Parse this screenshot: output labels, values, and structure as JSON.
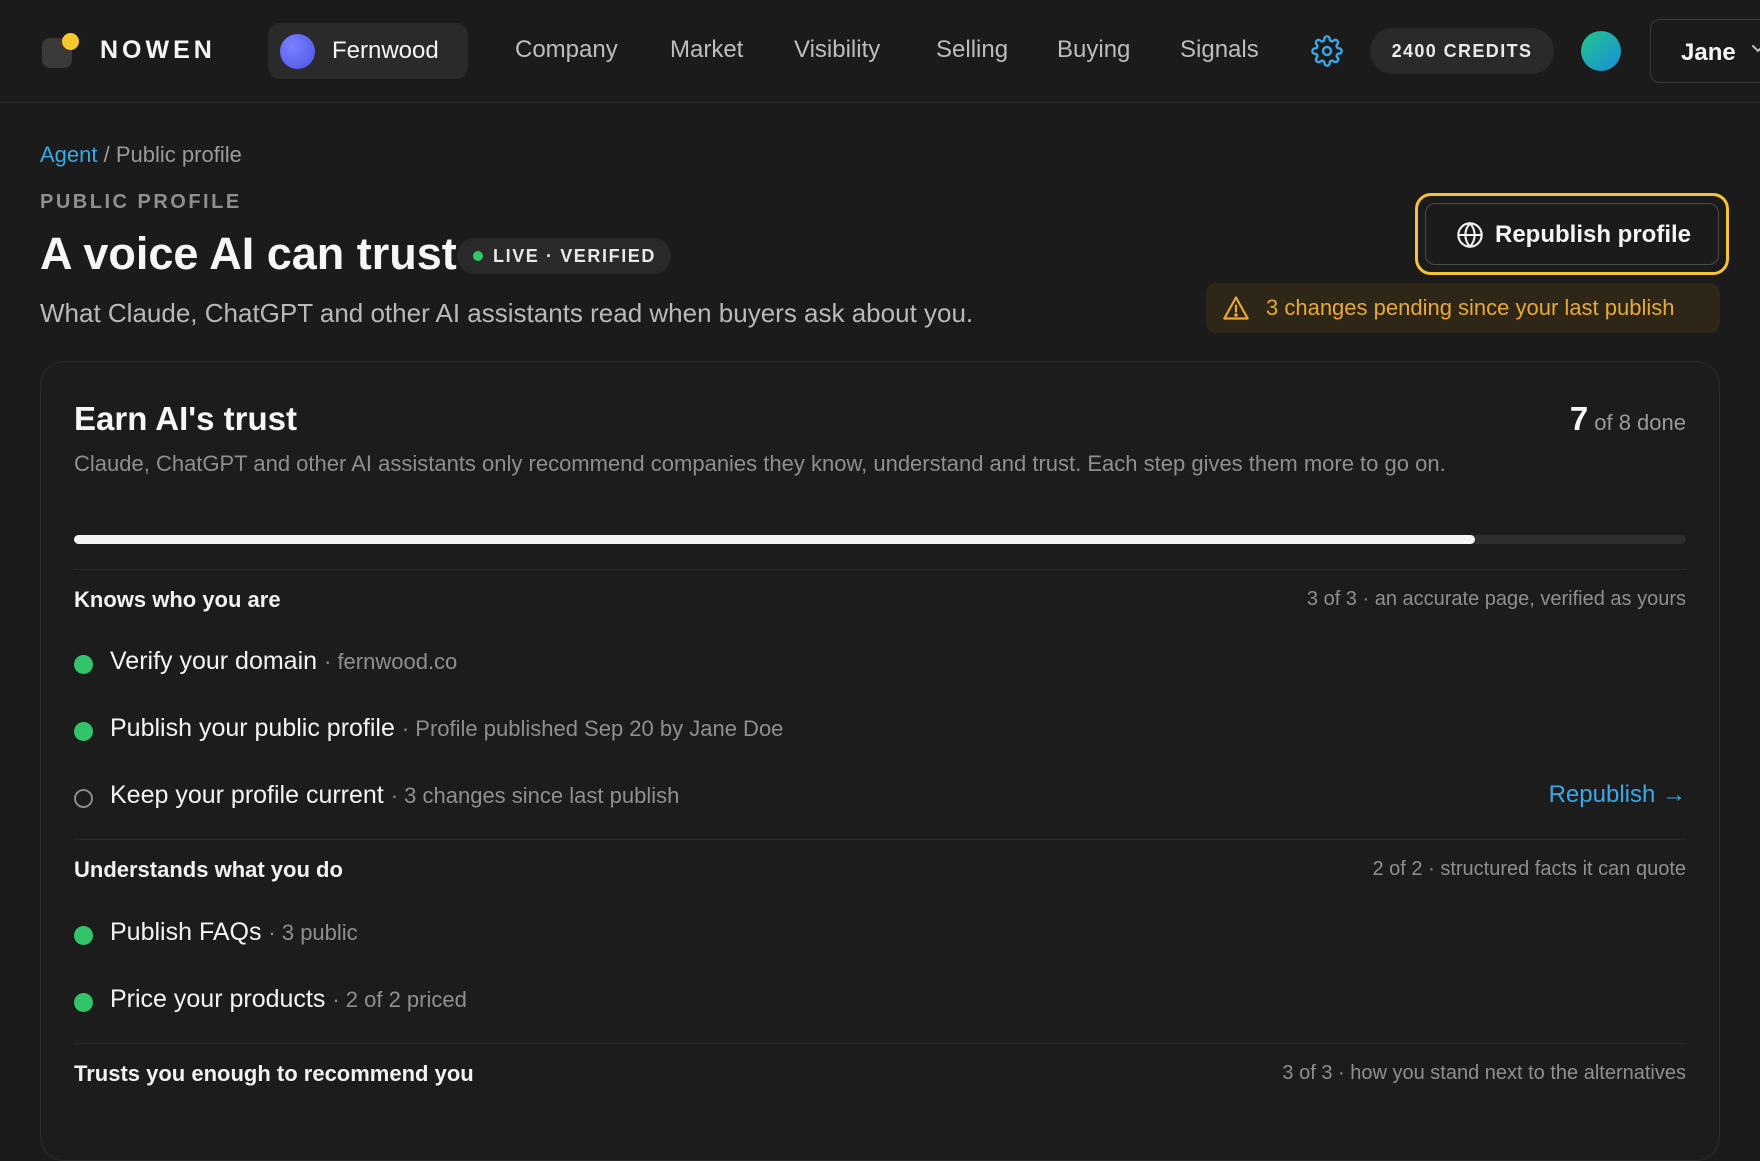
{
  "header": {
    "brand": "NOWEN",
    "workspace": "Fernwood",
    "nav": [
      "Company",
      "Market",
      "Visibility",
      "Selling",
      "Buying",
      "Signals"
    ],
    "credits": "2400 CREDITS",
    "user": "Jane"
  },
  "breadcrumb": {
    "link": "Agent",
    "separator": "/",
    "current": "Public profile"
  },
  "page": {
    "eyebrow": "PUBLIC PROFILE",
    "title": "A voice AI can trust",
    "status": "LIVE · VERIFIED",
    "subtitle": "What Claude, ChatGPT and other AI assistants read when buyers ask about you.",
    "republish_label": "Republish profile",
    "pending_notice": "3 changes pending since your last publish"
  },
  "card": {
    "title": "Earn AI's trust",
    "done_count": "7",
    "done_suffix": "of 8 done",
    "progress": 0.869,
    "description": "Claude, ChatGPT and other AI assistants only recommend companies they know, understand and trust. Each step gives them more to go on.",
    "sections": [
      {
        "title": "Knows who you are",
        "meta": "3 of 3 · an accurate page, verified as yours",
        "tasks": [
          {
            "label": "Verify your domain",
            "detail": "· fernwood.co",
            "done": true
          },
          {
            "label": "Publish your public profile",
            "detail": "· Profile published Sep 20 by Jane Doe",
            "done": true
          },
          {
            "label": "Keep your profile current",
            "detail": "· 3 changes since last publish",
            "done": false,
            "action": "Republish →"
          }
        ]
      },
      {
        "title": "Understands what you do",
        "meta": "2 of 2 · structured facts it can quote",
        "tasks": [
          {
            "label": "Publish FAQs",
            "detail": "· 3 public",
            "done": true
          },
          {
            "label": "Price your products",
            "detail": "· 2 of 2 priced",
            "done": true
          }
        ]
      },
      {
        "title": "Trusts you enough to recommend you",
        "meta": "3 of 3 · how you stand next to the alternatives",
        "tasks": []
      }
    ]
  },
  "colors": {
    "accent": "#3aa8e6",
    "success": "#33c46a",
    "warning": "#e9a83a",
    "highlight": "#f4c436",
    "background": "#1b1b1b"
  }
}
